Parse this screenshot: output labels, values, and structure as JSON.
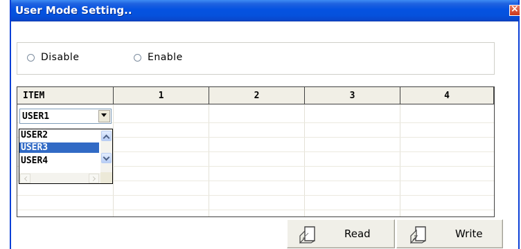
{
  "window": {
    "title": "User Mode Setting..",
    "close_glyph": "×"
  },
  "mode": {
    "options": [
      {
        "label": "Disable",
        "selected": false
      },
      {
        "label": "Enable",
        "selected": false
      }
    ]
  },
  "grid": {
    "columns": [
      "ITEM",
      "1",
      "2",
      "3",
      "4"
    ],
    "row_count": 7,
    "item_select": {
      "value": "USER1",
      "options": [
        "USER2",
        "USER3",
        "USER4"
      ],
      "highlighted": "USER3"
    }
  },
  "buttons": {
    "read": "Read",
    "write": "Write"
  },
  "icons": {
    "read": "read-document-icon",
    "write": "write-document-icon"
  },
  "colors": {
    "titlebar": "#0553e1",
    "selection": "#316ac5",
    "header_bg": "#f1efe6"
  }
}
